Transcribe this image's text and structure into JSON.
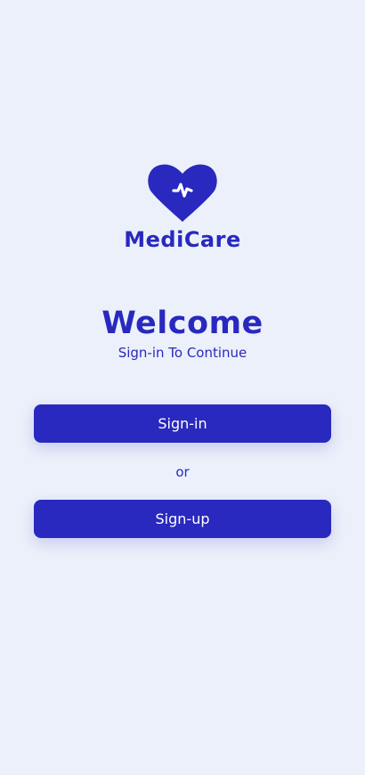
{
  "logo": {
    "icon": "heart-pulse-icon",
    "brand": "MediCare"
  },
  "welcome": {
    "title": "Welcome",
    "subtitle": "Sign-in To Continue"
  },
  "actions": {
    "signin_label": "Sign-in",
    "separator": "or",
    "signup_label": "Sign-up"
  },
  "colors": {
    "background": "#ecf0fa",
    "primary": "#2929bf",
    "button_text": "#ffffff"
  }
}
